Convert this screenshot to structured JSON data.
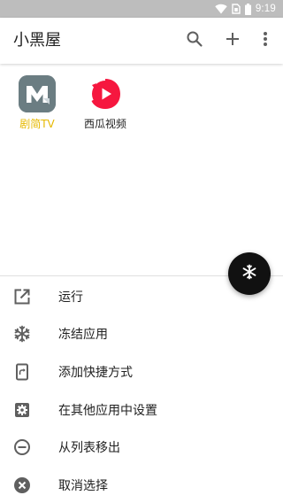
{
  "status_bar": {
    "time": "9:19",
    "icons": [
      "wifi-icon",
      "sim-icon",
      "battery-icon"
    ]
  },
  "app_bar": {
    "title": "小黑屋",
    "actions": [
      "search-icon",
      "add-icon",
      "more-vert-icon"
    ]
  },
  "apps": [
    {
      "label": "剧简TV",
      "label_color": "#e6b800",
      "icon": "jujian-tv-logo",
      "icon_bg": "#6a7b80",
      "selected": true
    },
    {
      "label": "西瓜视频",
      "label_color": "#212121",
      "icon": "xigua-video-logo",
      "icon_bg": "#ffffff",
      "selected": false
    }
  ],
  "fab": {
    "icon": "snowflake-icon"
  },
  "menu": {
    "items": [
      {
        "label": "运行",
        "icon": "open-external-icon"
      },
      {
        "label": "冻结应用",
        "icon": "snowflake-icon"
      },
      {
        "label": "添加快捷方式",
        "icon": "add-shortcut-icon"
      },
      {
        "label": "在其他应用中设置",
        "icon": "settings-gear-icon"
      },
      {
        "label": "从列表移出",
        "icon": "remove-circle-icon"
      },
      {
        "label": "取消选择",
        "icon": "cancel-circle-icon"
      }
    ]
  },
  "colors": {
    "status_bar": "#bdbdbd",
    "fab": "#111111",
    "icon_gray": "#5f5f5f",
    "xigua_red": "#f6173f",
    "selected_label": "#e6b800"
  }
}
